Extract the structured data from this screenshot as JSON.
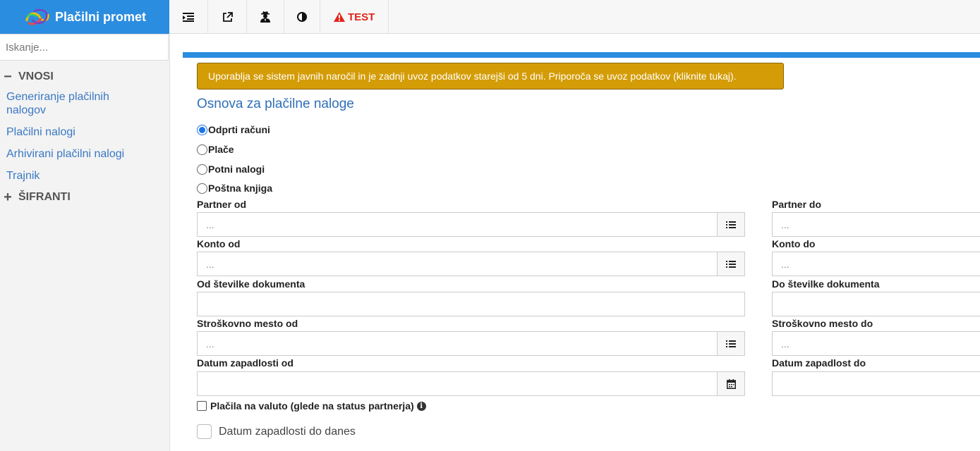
{
  "app": {
    "title": "Plačilni promet"
  },
  "sidebar": {
    "search_placeholder": "Iskanje...",
    "sections": [
      {
        "label": "VNOSI",
        "symbol": "−"
      },
      {
        "label": "ŠIFRANTI",
        "symbol": "+"
      }
    ],
    "items": [
      {
        "label": "Generiranje plačilnih nalogov"
      },
      {
        "label": "Plačilni nalogi"
      },
      {
        "label": "Arhivirani plačilni nalogi"
      },
      {
        "label": "Trajnik"
      }
    ]
  },
  "toolbar": {
    "icons": [
      "indent-list-icon",
      "external-link-icon",
      "user-secret-icon",
      "contrast-icon"
    ],
    "test_label": "TEST"
  },
  "alert": {
    "text": "Uporablja se sistem javnih naročil in je zadnji uvoz podatkov starejši od 5 dni. Priporoča se uvoz podatkov (kliknite tukaj)."
  },
  "form": {
    "title": "Osnova za plačilne naloge",
    "radios": [
      {
        "label": "Odprti računi",
        "checked": true
      },
      {
        "label": "Plače",
        "checked": false
      },
      {
        "label": "Potni nalogi",
        "checked": false
      },
      {
        "label": "Poštna knjiga",
        "checked": false
      }
    ],
    "fields": {
      "partner_od": {
        "label": "Partner od",
        "placeholder": "..."
      },
      "partner_do": {
        "label": "Partner do",
        "placeholder": "..."
      },
      "konto_od": {
        "label": "Konto od",
        "placeholder": "..."
      },
      "konto_do": {
        "label": "Konto do",
        "placeholder": "..."
      },
      "dok_od": {
        "label": "Od številke dokumenta",
        "placeholder": ""
      },
      "dok_do": {
        "label": "Do številke dokumenta",
        "placeholder": ""
      },
      "strm_od": {
        "label": "Stroškovno mesto od",
        "placeholder": "..."
      },
      "strm_do": {
        "label": "Stroškovno mesto do",
        "placeholder": "..."
      },
      "dz_od": {
        "label": "Datum zapadlosti od",
        "placeholder": ""
      },
      "dz_do": {
        "label": "Datum zapadlost do",
        "placeholder": ""
      }
    },
    "checkbox_valuta": {
      "label": "Plačila na valuto (glede na status partnerja)",
      "info": "i"
    },
    "checkbox_danes": {
      "label": "Datum zapadlosti do danes"
    }
  }
}
